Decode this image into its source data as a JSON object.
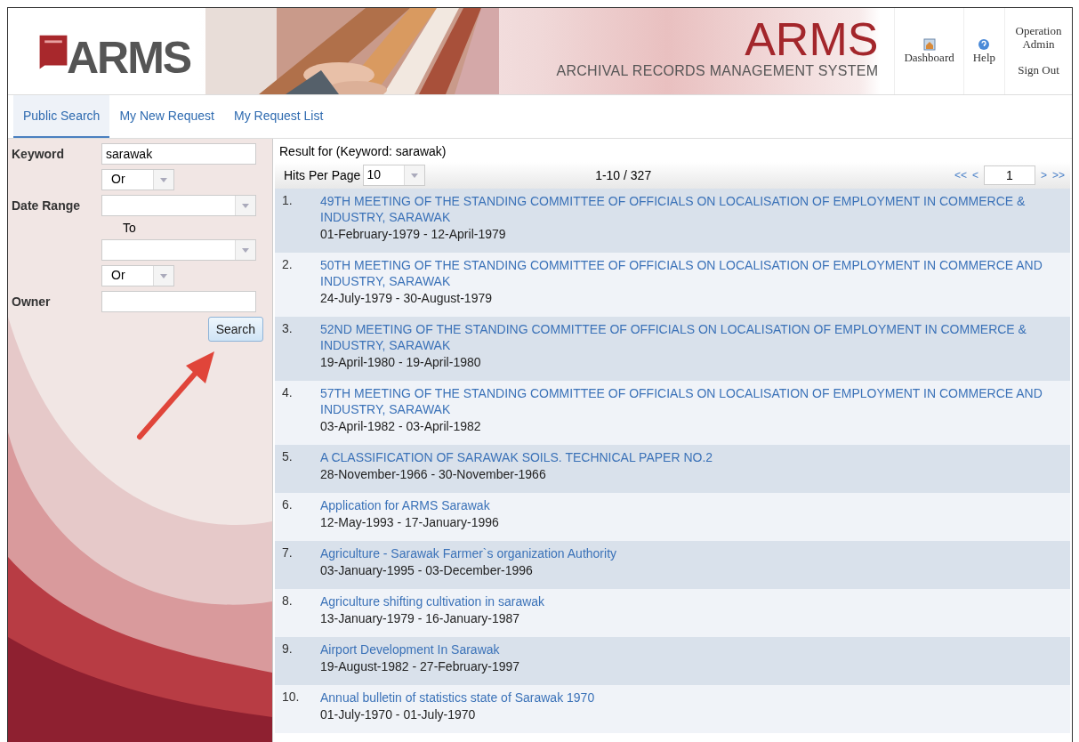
{
  "header": {
    "logo": "ARMS",
    "title": "ARMS",
    "subtitle": "ARCHIVAL RECORDS MANAGEMENT SYSTEM",
    "nav": [
      {
        "label": "Dashboard",
        "kind": "dashboard"
      },
      {
        "label": "Help",
        "kind": "help"
      }
    ],
    "user": {
      "name": "Operation Admin",
      "sign_out": "Sign Out"
    }
  },
  "tabs": [
    {
      "label": "Public Search",
      "selected": true
    },
    {
      "label": "My New Request",
      "selected": false
    },
    {
      "label": "My Request List",
      "selected": false
    }
  ],
  "search_form": {
    "keyword_label": "Keyword",
    "keyword_value": "sarawak",
    "keyword_operator": "Or",
    "date_range_label": "Date Range",
    "to_label": "To",
    "date_operator": "Or",
    "owner_label": "Owner",
    "search_button": "Search"
  },
  "results": {
    "heading": "Result for (Keyword: sarawak)",
    "hits_label": "Hits Per Page",
    "hits_value": "10",
    "range": "1-10 / 327",
    "pager": {
      "first": "<<",
      "prev": "<",
      "page": "1",
      "next": ">",
      "last": ">>"
    },
    "items": [
      {
        "number": "1.",
        "title": "49TH MEETING OF THE STANDING COMMITTEE OF OFFICIALS ON LOCALISATION OF EMPLOYMENT IN COMMERCE & INDUSTRY, SARAWAK",
        "dates": "01-February-1979 - 12-April-1979"
      },
      {
        "number": "2.",
        "title": "50TH MEETING OF THE STANDING COMMITTEE OF OFFICIALS ON LOCALISATION OF EMPLOYMENT IN COMMERCE AND INDUSTRY, SARAWAK",
        "dates": "24-July-1979 - 30-August-1979"
      },
      {
        "number": "3.",
        "title": "52ND MEETING OF THE STANDING COMMITTEE OF OFFICIALS ON LOCALISATION OF EMPLOYMENT IN COMMERCE & INDUSTRY, SARAWAK",
        "dates": "19-April-1980 - 19-April-1980"
      },
      {
        "number": "4.",
        "title": "57TH MEETING OF THE STANDING COMMITTEE OF OFFICIALS ON LOCALISATION OF EMPLOYMENT IN COMMERCE AND INDUSTRY, SARAWAK",
        "dates": "03-April-1982 - 03-April-1982"
      },
      {
        "number": "5.",
        "title": "A CLASSIFICATION OF SARAWAK SOILS. TECHNICAL PAPER NO.2",
        "dates": "28-November-1966 - 30-November-1966"
      },
      {
        "number": "6.",
        "title": "Application for ARMS Sarawak",
        "dates": "12-May-1993 - 17-January-1996"
      },
      {
        "number": "7.",
        "title": "Agriculture - Sarawak Farmer`s organization Authority",
        "dates": "03-January-1995 - 03-December-1996"
      },
      {
        "number": "8.",
        "title": "Agriculture shifting cultivation in sarawak",
        "dates": "13-January-1979 - 16-January-1987"
      },
      {
        "number": "9.",
        "title": "Airport Development In Sarawak",
        "dates": "19-August-1982 - 27-February-1997"
      },
      {
        "number": "10.",
        "title": "Annual bulletin of statistics state of Sarawak 1970",
        "dates": "01-July-1970 - 01-July-1970"
      }
    ]
  }
}
